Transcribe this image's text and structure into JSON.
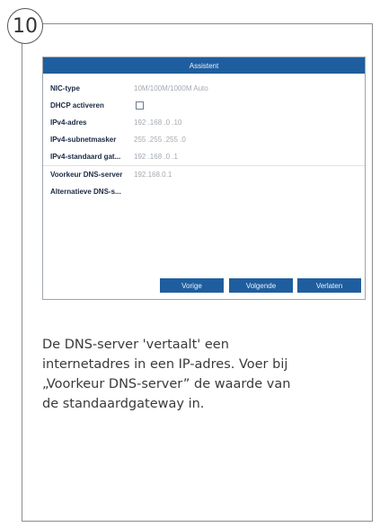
{
  "step_number": "10",
  "dialog": {
    "title": "Assistent",
    "fields": [
      {
        "label": "NIC-type",
        "value": "10M/100M/1000M Auto",
        "type": "text"
      },
      {
        "label": "DHCP activeren",
        "value": "",
        "type": "checkbox",
        "checked": false
      },
      {
        "label": "IPv4-adres",
        "value": "192 .168 .0   .10",
        "type": "text"
      },
      {
        "label": "IPv4-subnetmasker",
        "value": "255 .255 .255 .0",
        "type": "text"
      },
      {
        "label": "IPv4-standaard gat...",
        "value": "192 .168 .0   .1",
        "type": "text"
      },
      {
        "label": "Voorkeur DNS-server",
        "value": "192.168.0.1",
        "type": "text"
      },
      {
        "label": "Alternatieve DNS-s...",
        "value": "",
        "type": "text"
      }
    ],
    "buttons": {
      "previous": "Vorige",
      "next": "Volgende",
      "exit": "Verlaten"
    }
  },
  "caption_lines": [
    "De DNS-server 'vertaalt' een",
    "internetadres in een IP-adres. Voer bij",
    "„Voorkeur DNS-server” de waarde van",
    "de standaardgateway in."
  ]
}
